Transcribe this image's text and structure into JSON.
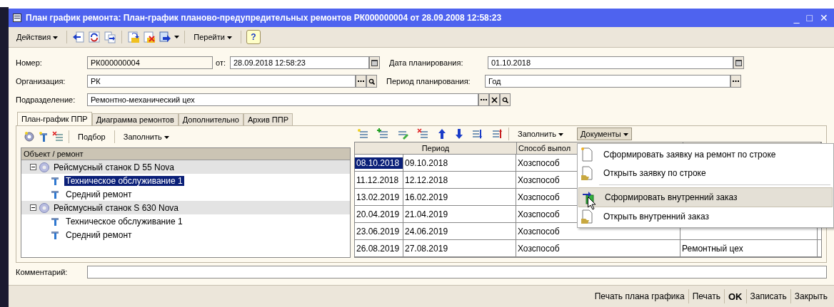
{
  "window": {
    "title": "План график ремонта: План-график планово-предупредительных ремонтов РК000000004 от 28.09.2008 12:58:23",
    "controls": [
      "_",
      "□",
      "✕"
    ]
  },
  "toolbar": {
    "actions": "Действия",
    "goto": "Перейти",
    "help": "?"
  },
  "form": {
    "number_label": "Номер:",
    "number": "РК000000004",
    "date_label": "от:",
    "date": "28.09.2018 12:58:23",
    "plan_date_label": "Дата планирования:",
    "plan_date": "01.10.2018",
    "org_label": "Организация:",
    "org": "РК",
    "period_label": "Период планирования:",
    "period": "Год",
    "dept_label": "Подразделение:",
    "dept": "Ремонтно-механический цех"
  },
  "tabs": [
    {
      "label": "План-график ППР",
      "selected": true
    },
    {
      "label": "Диаграмма ремонтов",
      "selected": false
    },
    {
      "label": "Дополнительно",
      "selected": false
    },
    {
      "label": "Архив ППР",
      "selected": false
    }
  ],
  "tree_toolbar": {
    "pick": "Подбор",
    "fill": "Заполнить"
  },
  "tree": {
    "column": "Объект / ремонт",
    "items": [
      {
        "label": "Рейсмусный станок D 55 Nova",
        "selected": false,
        "expanded": true,
        "children": [
          {
            "label": "Техническое обслуживание 1",
            "selected": true
          },
          {
            "label": "Средний ремонт",
            "selected": false
          }
        ]
      },
      {
        "label": "Рейсмусный станок S 630 Nova",
        "selected": false,
        "expanded": true,
        "children": [
          {
            "label": "Техническое обслуживание 1",
            "selected": false
          },
          {
            "label": "Средний ремонт",
            "selected": false
          }
        ]
      }
    ]
  },
  "grid_toolbar": {
    "fill": "Заполнить",
    "documents": "Документы",
    "documents_open": true
  },
  "grid": {
    "columns": [
      "Период",
      "Способ выпол"
    ],
    "rows": [
      {
        "start": "08.10.2018",
        "end": "09.10.2018",
        "method": "Хозспособ",
        "selected": true
      },
      {
        "start": "11.12.2018",
        "end": "12.12.2018",
        "method": "Хозспособ",
        "selected": false
      },
      {
        "start": "13.02.2019",
        "end": "16.02.2019",
        "method": "Хозспособ",
        "selected": false
      },
      {
        "start": "20.04.2019",
        "end": "21.04.2019",
        "method": "Хозспособ",
        "selected": false
      },
      {
        "start": "23.06.2019",
        "end": "24.06.2019",
        "method": "Хозспособ",
        "selected": false
      },
      {
        "start": "26.08.2019",
        "end": "27.08.2019",
        "method": "Хозспособ",
        "column_4": "Ремонтный цех",
        "selected": false
      }
    ]
  },
  "menu": {
    "items": [
      {
        "label": "Сформировать заявку на ремонт по строке",
        "kind": "new",
        "separator_before": false,
        "selected": false
      },
      {
        "label": "Открыть заявку по строке",
        "kind": "open",
        "separator_before": false,
        "selected": false
      },
      {
        "label": "Сформировать внутренний заказ",
        "kind": "create",
        "separator_before": true,
        "selected": true
      },
      {
        "label": "Открыть внутренний заказ",
        "kind": "open",
        "separator_before": false,
        "selected": false
      }
    ]
  },
  "comment": {
    "label": "Комментарий:"
  },
  "buttons": [
    {
      "label": "Печать плана графика",
      "default": false
    },
    {
      "label": "Печать",
      "default": false
    },
    {
      "label": "OK",
      "default": true
    },
    {
      "label": "Записать",
      "default": false
    },
    {
      "label": "Закрыть",
      "default": false
    }
  ]
}
